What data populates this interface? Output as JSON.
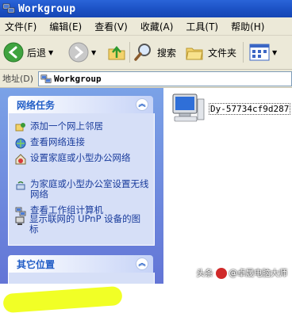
{
  "window": {
    "title": "Workgroup"
  },
  "menu": [
    "文件(F)",
    "编辑(E)",
    "查看(V)",
    "收藏(A)",
    "工具(T)",
    "帮助(H)"
  ],
  "toolbar": {
    "back_label": "后退",
    "search_label": "搜索",
    "folders_label": "文件夹"
  },
  "address": {
    "label": "地址(D)",
    "value": "Workgroup"
  },
  "network_tasks": {
    "title": "网络任务",
    "items": [
      "添加一个网上邻居",
      "查看网络连接",
      "设置家庭或小型办公网络",
      "为家庭或小型办公室设置无线网络",
      "查看工作组计算机",
      "显示联网的 UPnP 设备的图标"
    ]
  },
  "other_places": {
    "title": "其它位置"
  },
  "content": {
    "computer_name": "Dy-57734cf9d287"
  },
  "watermark": {
    "prefix": "头条",
    "text": "@卓晟电脑大师"
  },
  "colors": {
    "titlebar": "#1a4fc2",
    "task_link": "#1a3c9c",
    "panel_title": "#215dc6",
    "highlight": "#eeff00"
  }
}
